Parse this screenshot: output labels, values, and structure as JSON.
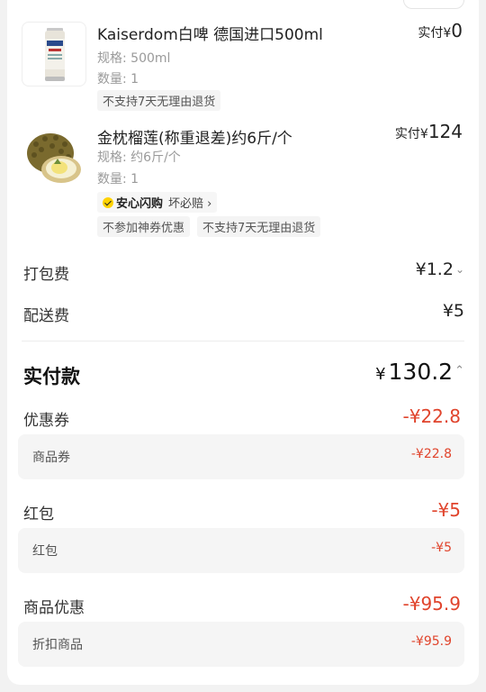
{
  "items": [
    {
      "title": "Kaiserdom白啤  德国进口500ml",
      "price_label": "实付¥",
      "price_value": "0",
      "spec": "规格: 500ml",
      "qty": "数量: 1",
      "tags": [
        "不支持7天无理由退货"
      ],
      "image_icon": "beer-can-image"
    },
    {
      "title": "金枕榴莲(称重退差)约6斤/个",
      "price_label": "实付¥",
      "price_value": "124",
      "spec": "规格: 约6斤/个",
      "qty": "数量: 1",
      "safe_label": "安心闪购",
      "safe_sub": "坏必赔 ›",
      "tags": [
        "不参加神券优惠",
        "不支持7天无理由退货"
      ],
      "image_icon": "durian-image"
    }
  ],
  "fees": {
    "packing_label": "打包费",
    "packing_value": "¥1.2",
    "delivery_label": "配送费",
    "delivery_value": "¥5"
  },
  "total": {
    "label": "实付款",
    "currency": "¥",
    "value": "130.2"
  },
  "discounts": [
    {
      "label": "优惠券",
      "value": "-¥22.8",
      "sub_label": "商品券",
      "sub_value": "-¥22.8"
    },
    {
      "label": "红包",
      "value": "-¥5",
      "sub_label": "红包",
      "sub_value": "-¥5"
    },
    {
      "label": "商品优惠",
      "value": "-¥95.9",
      "sub_label": "折扣商品",
      "sub_value": "-¥95.9"
    }
  ],
  "colors": {
    "discount": "#e0442c",
    "badge": "#ffd200"
  }
}
